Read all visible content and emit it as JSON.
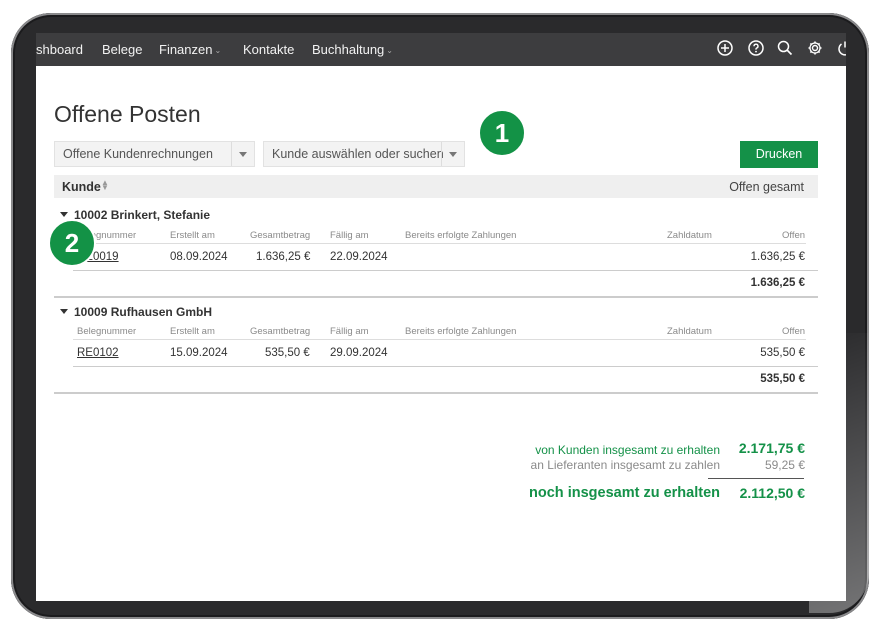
{
  "nav": {
    "items": [
      {
        "label": "shboard",
        "has_caret": false
      },
      {
        "label": "Belege",
        "has_caret": false
      },
      {
        "label": "Finanzen",
        "has_caret": true
      },
      {
        "label": "Kontakte",
        "has_caret": false
      },
      {
        "label": "Buchhaltung",
        "has_caret": true
      }
    ],
    "icons": [
      "plus-circle-icon",
      "help-icon",
      "search-icon",
      "gear-icon",
      "power-icon"
    ]
  },
  "page": {
    "title": "Offene Posten",
    "filter_select": "Offene Kundenrechnungen",
    "customer_select": "Kunde auswählen oder suchen",
    "print_button": "Drucken"
  },
  "badges": [
    "1",
    "2"
  ],
  "table": {
    "col_customer": "Kunde",
    "col_total_open": "Offen gesamt",
    "columns": [
      "Belegnummer",
      "Erstellt am",
      "Gesamtbetrag",
      "Fällig am",
      "Bereits erfolgte Zahlungen",
      "Zahldatum",
      "Offen"
    ],
    "groups": [
      {
        "title": "10002 Brinkert, Stefanie",
        "rows": [
          {
            "number": "RE0019",
            "created": "08.09.2024",
            "total": "1.636,25 €",
            "due": "22.09.2024",
            "paid": "",
            "pay_date": "",
            "open": "1.636,25 €"
          }
        ],
        "sum": "1.636,25 €"
      },
      {
        "title": "10009 Rufhausen GmbH",
        "rows": [
          {
            "number": "RE0102",
            "created": "15.09.2024",
            "total": "535,50 €",
            "due": "29.09.2024",
            "paid": "",
            "pay_date": "",
            "open": "535,50 €"
          }
        ],
        "sum": "535,50 €"
      }
    ]
  },
  "summary": {
    "receivable_label": "von Kunden insgesamt zu erhalten",
    "receivable_value": "2.171,75 €",
    "payable_label": "an Lieferanten insgesamt zu zahlen",
    "payable_value": "59,25 €",
    "net_label": "noch insgesamt zu erhalten",
    "net_value": "2.112,50 €"
  },
  "colors": {
    "accent": "#149148",
    "navbar": "#3d3d3f"
  }
}
